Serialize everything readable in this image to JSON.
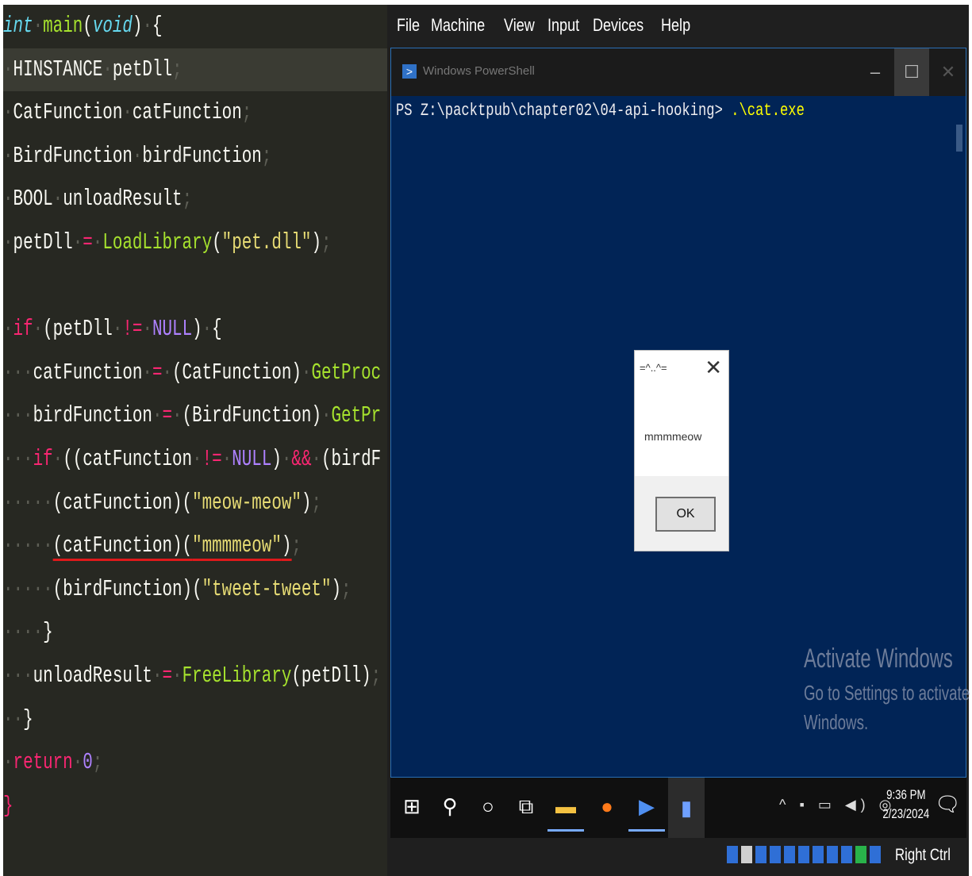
{
  "editor": {
    "lines": [
      {
        "ws": "",
        "parts": [
          {
            "c": "type",
            "t": "int"
          },
          {
            "c": "ws",
            "t": "·"
          },
          {
            "c": "fn",
            "t": "main"
          },
          {
            "c": "punct",
            "t": "("
          },
          {
            "c": "type",
            "t": "void"
          },
          {
            "c": "punct",
            "t": ")"
          },
          {
            "c": "ws",
            "t": "·"
          },
          {
            "c": "punct",
            "t": "{"
          }
        ]
      },
      {
        "ws": "·",
        "parts": [
          {
            "c": "punct",
            "t": "HINSTANCE"
          },
          {
            "c": "ws",
            "t": "·"
          },
          {
            "c": "punct",
            "t": "petDll"
          },
          {
            "c": "ws",
            "t": ";"
          }
        ],
        "current": true
      },
      {
        "ws": "·",
        "parts": [
          {
            "c": "punct",
            "t": "CatFunction"
          },
          {
            "c": "ws",
            "t": "·"
          },
          {
            "c": "punct",
            "t": "catFunction"
          },
          {
            "c": "ws",
            "t": ";"
          }
        ]
      },
      {
        "ws": "·",
        "parts": [
          {
            "c": "punct",
            "t": "BirdFunction"
          },
          {
            "c": "ws",
            "t": "·"
          },
          {
            "c": "punct",
            "t": "birdFunction"
          },
          {
            "c": "ws",
            "t": ";"
          }
        ]
      },
      {
        "ws": "·",
        "parts": [
          {
            "c": "punct",
            "t": "BOOL"
          },
          {
            "c": "ws",
            "t": "·"
          },
          {
            "c": "punct",
            "t": "unloadResult"
          },
          {
            "c": "ws",
            "t": ";"
          }
        ]
      },
      {
        "ws": "·",
        "parts": [
          {
            "c": "punct",
            "t": "petDll"
          },
          {
            "c": "ws",
            "t": "·"
          },
          {
            "c": "op",
            "t": "="
          },
          {
            "c": "ws",
            "t": "·"
          },
          {
            "c": "fn",
            "t": "LoadLibrary"
          },
          {
            "c": "punct",
            "t": "("
          },
          {
            "c": "str",
            "t": "\"pet.dll\""
          },
          {
            "c": "punct",
            "t": ")"
          },
          {
            "c": "ws",
            "t": ";"
          }
        ]
      },
      {
        "ws": "",
        "parts": []
      },
      {
        "ws": "·",
        "parts": [
          {
            "c": "kw",
            "t": "if"
          },
          {
            "c": "ws",
            "t": "·"
          },
          {
            "c": "punct",
            "t": "(petDll"
          },
          {
            "c": "ws",
            "t": "·"
          },
          {
            "c": "op",
            "t": "!="
          },
          {
            "c": "ws",
            "t": "·"
          },
          {
            "c": "const",
            "t": "NULL"
          },
          {
            "c": "punct",
            "t": ")"
          },
          {
            "c": "ws",
            "t": "·"
          },
          {
            "c": "punct",
            "t": "{"
          }
        ]
      },
      {
        "ws": "···",
        "parts": [
          {
            "c": "punct",
            "t": "catFunction"
          },
          {
            "c": "ws",
            "t": "·"
          },
          {
            "c": "op",
            "t": "="
          },
          {
            "c": "ws",
            "t": "·"
          },
          {
            "c": "punct",
            "t": "(CatFunction)"
          },
          {
            "c": "ws",
            "t": "·"
          },
          {
            "c": "fn",
            "t": "GetProc"
          }
        ]
      },
      {
        "ws": "···",
        "parts": [
          {
            "c": "punct",
            "t": "birdFunction"
          },
          {
            "c": "ws",
            "t": "·"
          },
          {
            "c": "op",
            "t": "="
          },
          {
            "c": "ws",
            "t": "·"
          },
          {
            "c": "punct",
            "t": "(BirdFunction)"
          },
          {
            "c": "ws",
            "t": "·"
          },
          {
            "c": "fn",
            "t": "GetPr"
          }
        ]
      },
      {
        "ws": "···",
        "parts": [
          {
            "c": "kw",
            "t": "if"
          },
          {
            "c": "ws",
            "t": "·"
          },
          {
            "c": "punct",
            "t": "((catFunction"
          },
          {
            "c": "ws",
            "t": "·"
          },
          {
            "c": "op",
            "t": "!="
          },
          {
            "c": "ws",
            "t": "·"
          },
          {
            "c": "const",
            "t": "NULL"
          },
          {
            "c": "punct",
            "t": ")"
          },
          {
            "c": "ws",
            "t": "·"
          },
          {
            "c": "op",
            "t": "&&"
          },
          {
            "c": "ws",
            "t": "·"
          },
          {
            "c": "punct",
            "t": "(birdF"
          }
        ]
      },
      {
        "ws": "·····",
        "parts": [
          {
            "c": "punct",
            "t": "(catFunction)("
          },
          {
            "c": "str",
            "t": "\"meow-meow\""
          },
          {
            "c": "punct",
            "t": ")"
          },
          {
            "c": "ws",
            "t": ";"
          }
        ]
      },
      {
        "ws": "·····",
        "parts": [
          {
            "c": "punct err",
            "t": "(catFunction)("
          },
          {
            "c": "str err",
            "t": "\"mmmmeow\""
          },
          {
            "c": "punct err",
            "t": ")"
          },
          {
            "c": "ws",
            "t": ";"
          }
        ]
      },
      {
        "ws": "·····",
        "parts": [
          {
            "c": "punct",
            "t": "(birdFunction)("
          },
          {
            "c": "str",
            "t": "\"tweet-tweet\""
          },
          {
            "c": "punct",
            "t": ")"
          },
          {
            "c": "ws",
            "t": ";"
          }
        ]
      },
      {
        "ws": "····",
        "parts": [
          {
            "c": "punct",
            "t": "}"
          }
        ]
      },
      {
        "ws": "···",
        "parts": [
          {
            "c": "punct",
            "t": "unloadResult"
          },
          {
            "c": "ws",
            "t": "·"
          },
          {
            "c": "op",
            "t": "="
          },
          {
            "c": "ws",
            "t": "·"
          },
          {
            "c": "fn",
            "t": "FreeLibrary"
          },
          {
            "c": "punct",
            "t": "(petDll)"
          },
          {
            "c": "ws",
            "t": ";"
          }
        ]
      },
      {
        "ws": "··",
        "parts": [
          {
            "c": "punct",
            "t": "}"
          }
        ]
      },
      {
        "ws": "·",
        "parts": [
          {
            "c": "kw",
            "t": "return"
          },
          {
            "c": "ws",
            "t": "·"
          },
          {
            "c": "num",
            "t": "0"
          },
          {
            "c": "ws",
            "t": ";"
          }
        ]
      },
      {
        "ws": "",
        "parts": [
          {
            "c": "kw",
            "t": "}"
          }
        ]
      }
    ]
  },
  "vm": {
    "menu": [
      "File",
      "Machine",
      "View",
      "Input",
      "Devices",
      "Help"
    ],
    "host_key": "Right Ctrl"
  },
  "powershell": {
    "title": "Windows PowerShell",
    "prompt": "PS Z:\\packtpub\\chapter02\\04-api-hooking> ",
    "command": ".\\cat.exe"
  },
  "msgbox": {
    "title": "=^..^=",
    "message": "mmmmeow",
    "ok_label": "OK"
  },
  "activate": {
    "line1": "Activate Windows",
    "line2": "Go to Settings to activate",
    "line3": "Windows."
  },
  "taskbar": {
    "time": "9:36 PM",
    "date": "2/23/2024"
  },
  "icons": {
    "start": "windows-start-icon",
    "search": "search-icon",
    "cortana": "cortana-icon",
    "taskview": "task-view-icon",
    "explorer": "file-explorer-icon",
    "firefox": "firefox-icon",
    "powershell": "powershell-icon",
    "app": "active-app-icon",
    "notifications": "notifications-icon"
  },
  "colors": {
    "editor_bg": "#272822",
    "powershell_bg": "#012456",
    "accent": "#2f71c7"
  }
}
